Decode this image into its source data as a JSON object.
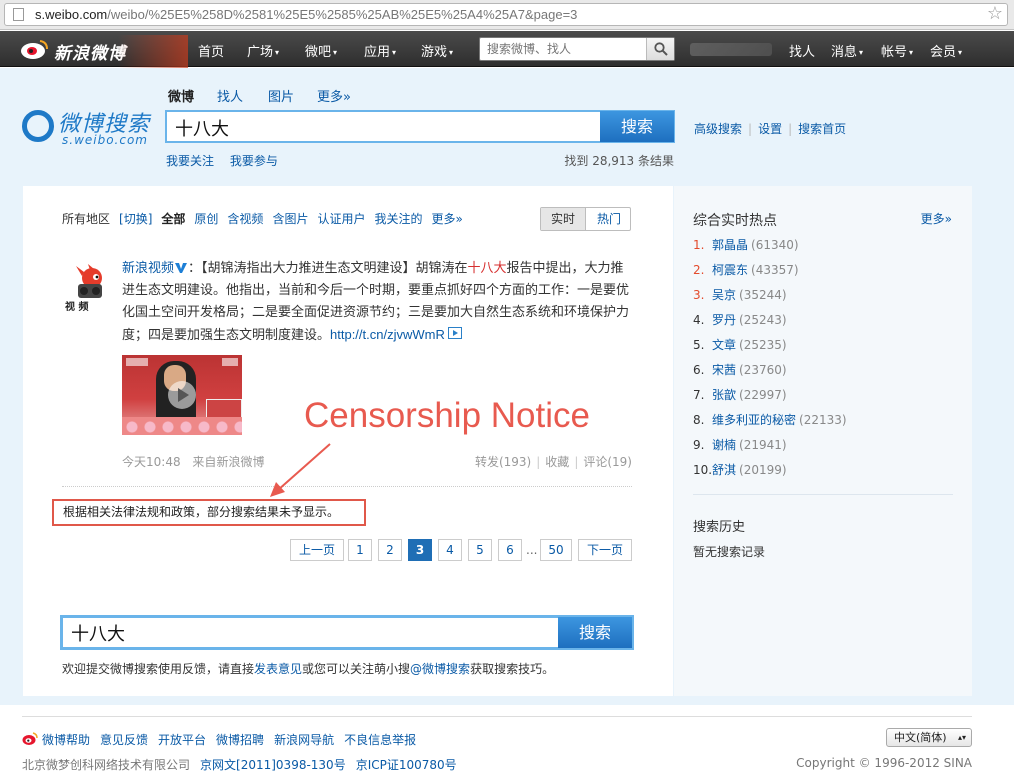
{
  "browser": {
    "url_host": "s.weibo.com",
    "url_path": "/weibo/%25E5%258D%2581%25E5%2585%25AB%25E5%25A4%25A7&page=3"
  },
  "topnav": {
    "logo_text": "新浪微博",
    "items": [
      {
        "label": "首页"
      },
      {
        "label": "广场"
      },
      {
        "label": "微吧"
      },
      {
        "label": "应用"
      },
      {
        "label": "游戏"
      }
    ],
    "search_placeholder": "搜索微博、找人",
    "right_items": [
      {
        "label": "找人"
      },
      {
        "label": "消息"
      },
      {
        "label": "帐号"
      },
      {
        "label": "会员"
      }
    ]
  },
  "header": {
    "logo_name": "微博搜索",
    "logo_domain": "s.weibo.com",
    "tabs": [
      {
        "label": "微博"
      },
      {
        "label": "找人"
      },
      {
        "label": "图片"
      },
      {
        "label": "更多»"
      }
    ],
    "query": "十八大",
    "search_button": "搜索",
    "links": [
      "高级搜索",
      "设置",
      "搜索首页"
    ],
    "sub_links": [
      "我要关注",
      "我要参与"
    ],
    "result_count": "找到 28,913 条结果"
  },
  "filters": {
    "region": "所有地区",
    "switch": "[切换]",
    "items": [
      "全部",
      "原创",
      "含视频",
      "含图片",
      "认证用户",
      "我关注的",
      "更多»"
    ],
    "sort": [
      "实时",
      "热门"
    ]
  },
  "post": {
    "author": "新浪视频",
    "avatar_label": "视 频",
    "text_before": "：【胡锦涛指出大力推进生态文明建设】胡锦涛在",
    "highlight": "十八大",
    "text_after": "报告中提出，大力推进生态文明建设。他指出，当前和今后一个时期，要重点抓好四个方面的工作：一是要优化国土空间开发格局；二是要全面促进资源节约；三是要加大自然生态系统和环境保护力度；四是要加强生态文明制度建设。",
    "link": "http://t.cn/zjvwWmR",
    "time": "今天10:48",
    "source_prefix": "来自",
    "source": "新浪微博",
    "forward": "转发(193)",
    "favorite": "收藏",
    "comment": "评论(19)"
  },
  "notice": "根据相关法律法规和政策，部分搜索结果未予显示。",
  "annotation": "Censorship Notice",
  "pager": {
    "prev": "上一页",
    "pages": [
      "1",
      "2",
      "3",
      "4",
      "5",
      "6"
    ],
    "current": "3",
    "dots": "...",
    "last": "50",
    "next": "下一页"
  },
  "bottom_search": {
    "query": "十八大",
    "button": "搜索",
    "feedback_1": "欢迎提交微博搜索使用反馈，请直接",
    "feedback_link1": "发表意见",
    "feedback_2": "或您可以关注萌小搜",
    "feedback_link2": "@微博搜索",
    "feedback_3": "获取搜索技巧。"
  },
  "sidebar": {
    "hot_title": "综合实时热点",
    "more": "更多»",
    "hot": [
      {
        "rank": "1.",
        "name": "郭晶晶",
        "count": "(61340)"
      },
      {
        "rank": "2.",
        "name": "柯震东",
        "count": "(43357)"
      },
      {
        "rank": "3.",
        "name": "吴京",
        "count": "(35244)"
      },
      {
        "rank": "4.",
        "name": "罗丹",
        "count": "(25243)"
      },
      {
        "rank": "5.",
        "name": "文章",
        "count": "(25235)"
      },
      {
        "rank": "6.",
        "name": "宋茜",
        "count": "(23760)"
      },
      {
        "rank": "7.",
        "name": "张歆",
        "count": "(22997)"
      },
      {
        "rank": "8.",
        "name": "维多利亚的秘密",
        "count": "(22133)"
      },
      {
        "rank": "9.",
        "name": "谢楠",
        "count": "(21941)"
      },
      {
        "rank": "10.",
        "name": "舒淇",
        "count": "(20199)"
      }
    ],
    "history_title": "搜索历史",
    "history_empty": "暂无搜索记录"
  },
  "footer": {
    "links": [
      "微博帮助",
      "意见反馈",
      "开放平台",
      "微博招聘",
      "新浪网导航",
      "不良信息举报"
    ],
    "company": "北京微梦创科网络技术有限公司",
    "license1": "京网文[2011]0398-130号",
    "license2": "京ICP证100780号",
    "copyright": "Copyright © 1996-2012 SINA",
    "language": "中文(简体)"
  }
}
